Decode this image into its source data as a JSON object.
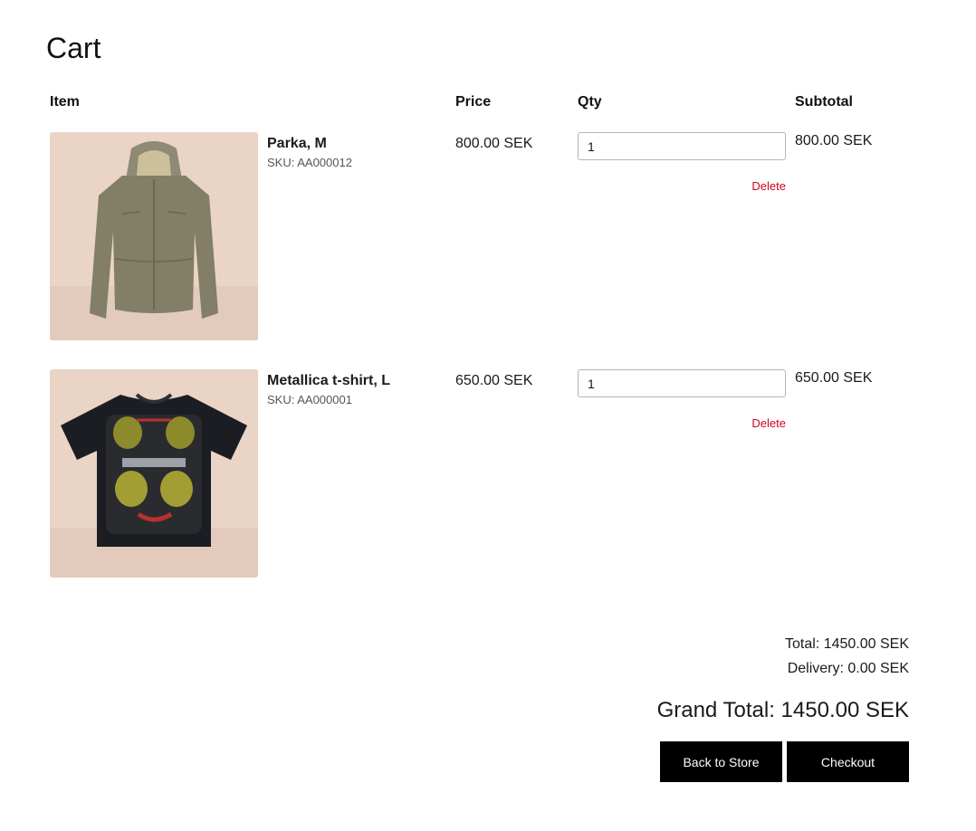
{
  "page": {
    "title": "Cart"
  },
  "table": {
    "headers": {
      "item": "Item",
      "price": "Price",
      "qty": "Qty",
      "subtotal": "Subtotal"
    }
  },
  "items": [
    {
      "name": "Parka, M",
      "sku": "SKU: AA000012",
      "price": "800.00 SEK",
      "qty": "1",
      "delete_label": "Delete",
      "subtotal": "800.00 SEK",
      "image_icon": "parka-photo"
    },
    {
      "name": "Metallica t-shirt, L",
      "sku": "SKU: AA000001",
      "price": "650.00 SEK",
      "qty": "1",
      "delete_label": "Delete",
      "subtotal": "650.00 SEK",
      "image_icon": "tshirt-photo"
    }
  ],
  "summary": {
    "total": "Total: 1450.00 SEK",
    "delivery": "Delivery: 0.00 SEK",
    "grand_total": "Grand Total: 1450.00 SEK"
  },
  "actions": {
    "back_label": "Back to Store",
    "checkout_label": "Checkout"
  },
  "colors": {
    "accent": "#000000",
    "delete": "#d0021b",
    "photo_background": "#e7d1c3"
  }
}
